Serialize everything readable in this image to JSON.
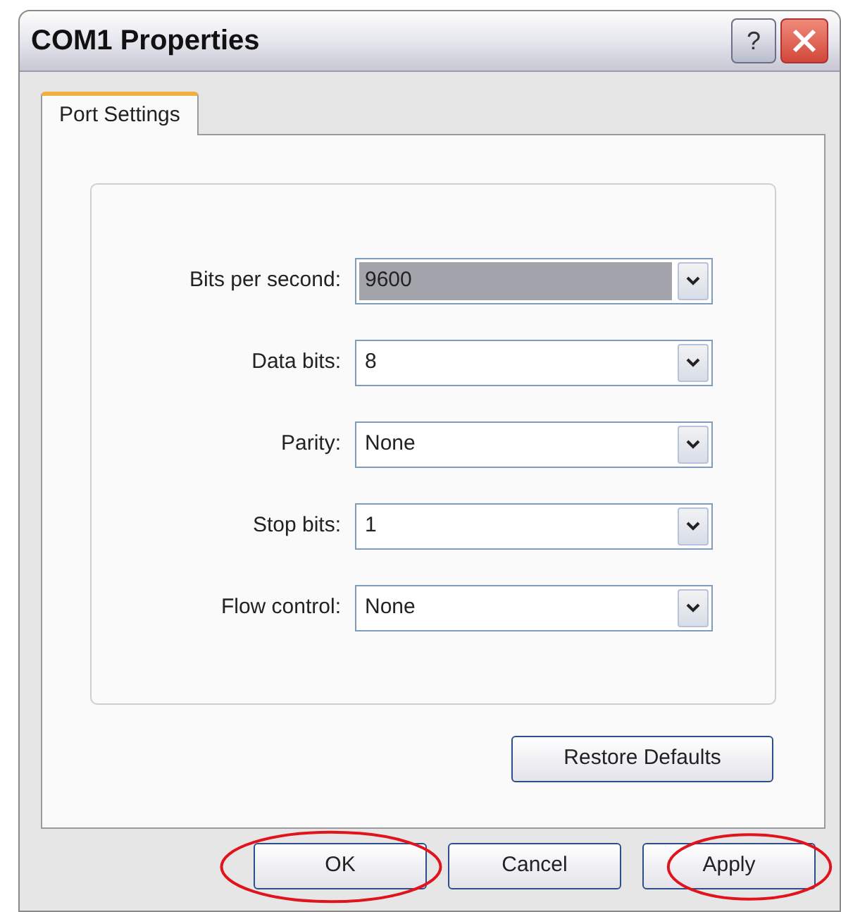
{
  "window": {
    "title": "COM1 Properties",
    "help_button": "?"
  },
  "tabs": [
    {
      "label": "Port Settings",
      "selected": true
    }
  ],
  "settings": [
    {
      "label": "Bits per second:",
      "value": "9600",
      "highlighted": true
    },
    {
      "label": "Data bits:",
      "value": "8",
      "highlighted": false
    },
    {
      "label": "Parity:",
      "value": "None",
      "highlighted": false
    },
    {
      "label": "Stop bits:",
      "value": "1",
      "highlighted": false
    },
    {
      "label": "Flow control:",
      "value": "None",
      "highlighted": false
    }
  ],
  "restore_button": "Restore Defaults",
  "buttons": [
    {
      "label": "OK",
      "circled": true
    },
    {
      "label": "Cancel",
      "circled": false
    },
    {
      "label": "Apply",
      "circled": true
    }
  ]
}
